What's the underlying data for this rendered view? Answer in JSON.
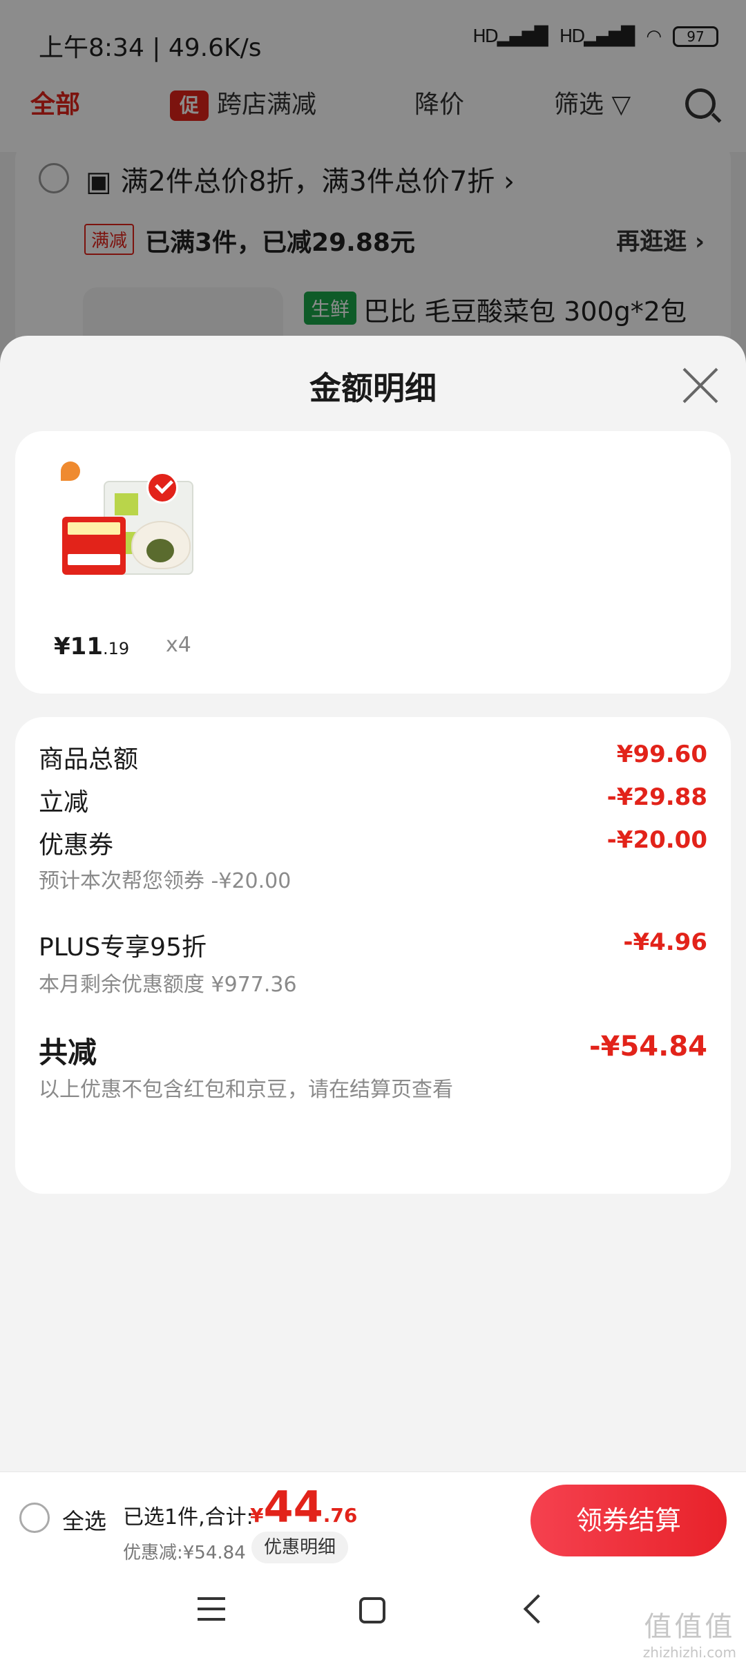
{
  "status_bar": {
    "time": "上午8:34 | 49.6K/s",
    "battery": "97",
    "signal": "HD"
  },
  "filter_bar": {
    "all": "全部",
    "promo_badge": "促",
    "cross_store": "跨店满减",
    "price_drop": "降价",
    "filter": "筛选"
  },
  "shop": {
    "promo_rule": "满2件总价8折，满3件总价7折",
    "tag": "满减",
    "saved": "已满3件，已减29.88元",
    "more": "再逛逛 ›",
    "fresh_tag": "生鲜",
    "product_name": "巴比 毛豆酸菜包 300g*2包"
  },
  "sheet": {
    "title": "金额明细",
    "item": {
      "price_int": "¥11",
      "price_dec": ".19",
      "qty": "x4"
    },
    "rows": [
      {
        "label": "商品总额",
        "amount": "¥99.60"
      },
      {
        "label": "立减",
        "amount": "-¥29.88"
      },
      {
        "label": "优惠券",
        "amount": "-¥20.00",
        "sub": "预计本次帮您领券 -¥20.00"
      },
      {
        "label": "PLUS专享95折",
        "amount": "-¥4.96",
        "sub": "本月剩余优惠额度 ¥977.36"
      }
    ],
    "total": {
      "label": "共减",
      "amount": "-¥54.84",
      "note": "以上优惠不包含红包和京豆，请在结算页查看"
    }
  },
  "checkout": {
    "select_all": "全选",
    "selected": "已选1件,合计:",
    "currency": "¥",
    "total_int": "44",
    "total_dec": ".76",
    "discount": "优惠减:¥54.84",
    "detail_btn": "优惠明细",
    "button": "领券结算"
  },
  "watermark": {
    "logo": "值值值",
    "url": "zhizhizhi.com"
  },
  "colors": {
    "accent": "#e2231a",
    "fresh": "#1aa74a"
  }
}
